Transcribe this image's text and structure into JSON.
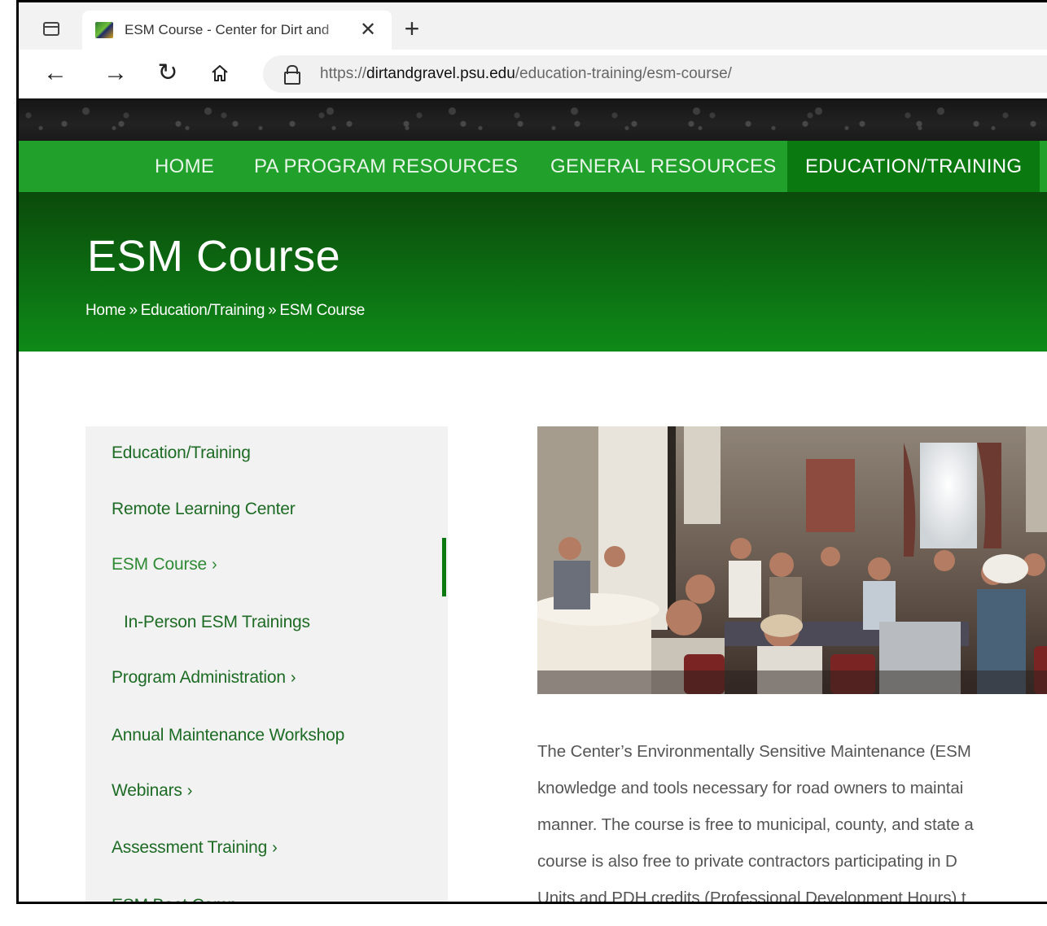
{
  "browser": {
    "tab_title": "ESM Course - Center for Dirt and",
    "tab_close": "✕",
    "new_tab": "+",
    "url_scheme": "https://",
    "url_host": "dirtandgravel.psu.edu",
    "url_path": "/education-training/esm-course/"
  },
  "nav": {
    "items": [
      {
        "label": "HOME"
      },
      {
        "label": "PA PROGRAM RESOURCES"
      },
      {
        "label": "GENERAL RESOURCES"
      },
      {
        "label": "EDUCATION/TRAINING",
        "active": true
      }
    ]
  },
  "header": {
    "title": "ESM Course",
    "breadcrumb": [
      "Home",
      "Education/Training",
      "ESM Course"
    ],
    "breadcrumb_sep": "»"
  },
  "sidebar": {
    "items": [
      {
        "label": "Education/Training"
      },
      {
        "label": "Remote Learning Center"
      },
      {
        "label": "ESM Course",
        "chevron": "›",
        "active": true
      },
      {
        "label": "In-Person ESM Trainings",
        "sub": true
      },
      {
        "label": "Program Administration",
        "chevron": "›"
      },
      {
        "label": "Annual Maintenance Workshop"
      },
      {
        "label": "Webinars",
        "chevron": "›"
      },
      {
        "label": "Assessment Training",
        "chevron": "›"
      },
      {
        "label": "ESM Boot Camp"
      }
    ]
  },
  "content": {
    "lines": [
      "The Center’s Environmentally Sensitive Maintenance (ESM",
      "knowledge and tools necessary for road owners to maintai",
      "manner. The course is free to municipal, county, and state a",
      "course is also free to private contractors participating in D",
      "Units and PDH credits (Professional Development Hours) t"
    ]
  },
  "colors": {
    "nav_green": "#22a02c",
    "nav_active": "#0a7a10",
    "link_green": "#1d6b24"
  }
}
